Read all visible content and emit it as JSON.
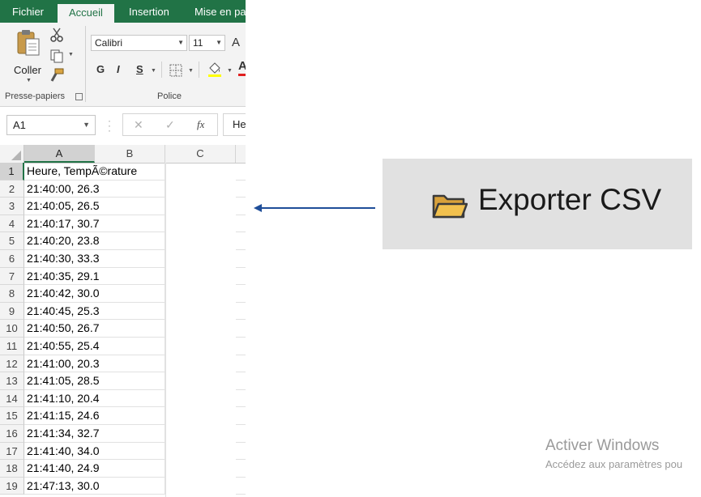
{
  "ribbon": {
    "tabs": [
      "Fichier",
      "Accueil",
      "Insertion",
      "Mise en pa"
    ],
    "active_tab": "Accueil",
    "clipboard": {
      "paste_label": "Coller",
      "group_label": "Presse-papiers"
    },
    "font": {
      "font_name": "Calibri",
      "font_size": "11",
      "grow_glyph": "A",
      "bold": "G",
      "italic": "I",
      "underline": "S",
      "group_label": "Police"
    }
  },
  "formula_bar": {
    "name_box": "A1",
    "cancel": "✕",
    "enter": "✓",
    "fx": "fx",
    "content": "He"
  },
  "sheet": {
    "columns": [
      "A",
      "B",
      "C"
    ],
    "rows": [
      {
        "n": "1",
        "a": "Heure, TempÃ©rature"
      },
      {
        "n": "2",
        "a": "21:40:00, 26.3"
      },
      {
        "n": "3",
        "a": "21:40:05, 26.5"
      },
      {
        "n": "4",
        "a": "21:40:17, 30.7"
      },
      {
        "n": "5",
        "a": "21:40:20, 23.8"
      },
      {
        "n": "6",
        "a": "21:40:30, 33.3"
      },
      {
        "n": "7",
        "a": "21:40:35, 29.1"
      },
      {
        "n": "8",
        "a": "21:40:42, 30.0"
      },
      {
        "n": "9",
        "a": "21:40:45, 25.3"
      },
      {
        "n": "10",
        "a": "21:40:50, 26.7"
      },
      {
        "n": "11",
        "a": "21:40:55, 25.4"
      },
      {
        "n": "12",
        "a": "21:41:00, 20.3"
      },
      {
        "n": "13",
        "a": "21:41:05, 28.5"
      },
      {
        "n": "14",
        "a": "21:41:10, 20.4"
      },
      {
        "n": "15",
        "a": "21:41:15, 24.6"
      },
      {
        "n": "16",
        "a": "21:41:34, 32.7"
      },
      {
        "n": "17",
        "a": "21:41:40, 34.0"
      },
      {
        "n": "18",
        "a": "21:41:40, 24.9"
      },
      {
        "n": "19",
        "a": "21:47:13, 30.0"
      }
    ]
  },
  "export_button": {
    "label": "Exporter CSV",
    "icon": "folder-icon"
  },
  "watermark": {
    "line1": "Activer Windows",
    "line2": "Accédez aux paramètres pou"
  },
  "colors": {
    "excel_green": "#217346",
    "arrow": "#1f4e99",
    "button_bg": "#e1e1e1"
  }
}
